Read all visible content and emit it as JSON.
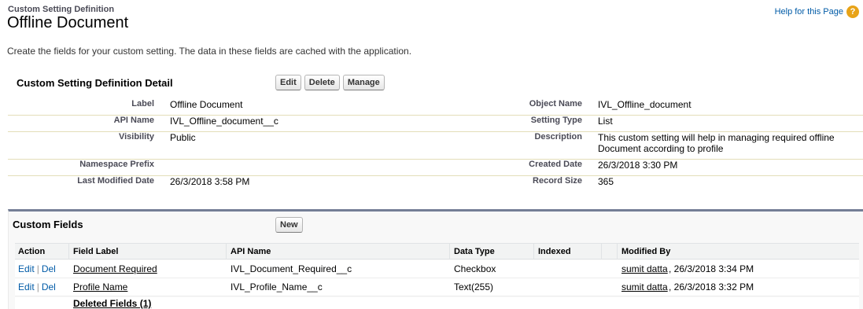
{
  "header": {
    "page_type": "Custom Setting Definition",
    "title": "Offline Document",
    "help_link": "Help for this Page",
    "help_icon": "?"
  },
  "description": "Create the fields for your custom setting. The data in these fields are cached with the application.",
  "detail": {
    "title": "Custom Setting Definition Detail",
    "buttons": {
      "edit": "Edit",
      "delete": "Delete",
      "manage": "Manage"
    },
    "rows": [
      {
        "label1": "Label",
        "value1": "Offline Document",
        "label2": "Object Name",
        "value2": "IVL_Offline_document"
      },
      {
        "label1": "API Name",
        "value1": "IVL_Offline_document__c",
        "label2": "Setting Type",
        "value2": "List"
      },
      {
        "label1": "Visibility",
        "value1": "Public",
        "label2": "Description",
        "value2": "This custom setting will help in managing required offline Document according to profile"
      },
      {
        "label1": "Namespace Prefix",
        "value1": "",
        "label2": "Created Date",
        "value2": "26/3/2018 3:30 PM"
      },
      {
        "label1": "Last Modified Date",
        "value1": "26/3/2018 3:58 PM",
        "label2": "Record Size",
        "value2": "365"
      }
    ]
  },
  "custom_fields": {
    "title": "Custom Fields",
    "new_button": "New",
    "columns": [
      "Action",
      "Field Label",
      "API Name",
      "Data Type",
      "Indexed",
      "Modified By"
    ],
    "rows": [
      {
        "edit": "Edit",
        "sep": "|",
        "del": "Del",
        "field_label": "Document Required",
        "api_name": "IVL_Document_Required__c",
        "data_type": "Checkbox",
        "indexed": "",
        "modified_by_user": "sumit datta",
        "modified_by_date": ", 26/3/2018 3:34 PM"
      },
      {
        "edit": "Edit",
        "sep": "|",
        "del": "Del",
        "field_label": "Profile Name",
        "api_name": "IVL_Profile_Name__c",
        "data_type": "Text(255)",
        "indexed": "",
        "modified_by_user": "sumit datta",
        "modified_by_date": ", 26/3/2018 3:32 PM"
      }
    ],
    "deleted_fields": "Deleted Fields (1)"
  },
  "colors": {
    "link": "#015ba7",
    "section_border": "#747e96",
    "help_icon": "#e8a317"
  }
}
